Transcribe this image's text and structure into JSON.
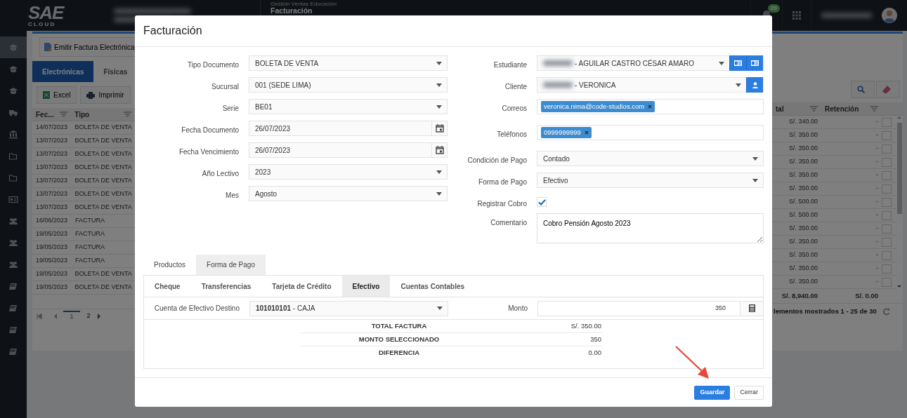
{
  "topbar": {
    "logo": "SAE",
    "logo_sub": "C L O U D",
    "module": "Gestión Ventas Educación",
    "page": "Facturación",
    "notifications": "20"
  },
  "sidebar": {
    "items": [
      {
        "kind": "cap",
        "selected": true
      },
      {
        "kind": "cap",
        "selected": false
      },
      {
        "kind": "cap",
        "selected": false
      },
      {
        "kind": "truck",
        "selected": false
      },
      {
        "kind": "bank",
        "selected": false
      },
      {
        "kind": "folder",
        "selected": false
      },
      {
        "kind": "folder",
        "selected": false
      },
      {
        "kind": "card",
        "selected": false
      },
      {
        "kind": "users",
        "selected": false
      },
      {
        "kind": "users",
        "selected": false
      },
      {
        "kind": "users",
        "selected": false
      },
      {
        "kind": "book",
        "selected": false
      },
      {
        "kind": "book",
        "selected": false
      },
      {
        "kind": "book",
        "selected": false
      },
      {
        "kind": "book",
        "selected": false
      }
    ]
  },
  "background": {
    "emit_button": "Emitir Factura Electrónica",
    "tabs": [
      {
        "label": "Electrónicas",
        "selected": true
      },
      {
        "label": "Físicas",
        "selected": false
      }
    ],
    "toolbar": [
      {
        "label": "Excel",
        "kind": "excel"
      },
      {
        "label": "Imprimir",
        "kind": "print"
      }
    ],
    "table": {
      "columns_left": [
        "Fec...",
        "Tipo"
      ],
      "columns_right": [
        "tal",
        "Retención"
      ],
      "rows": [
        {
          "fecha": "14/07/2023",
          "tipo": "BOLETA DE VENTA",
          "total": "S/. 340.00",
          "retencion": "-"
        },
        {
          "fecha": "13/07/2023",
          "tipo": "BOLETA DE VENTA",
          "total": "S/. 350.00",
          "retencion": "-"
        },
        {
          "fecha": "13/07/2023",
          "tipo": "BOLETA DE VENTA",
          "total": "S/. 350.00",
          "retencion": "-"
        },
        {
          "fecha": "13/07/2023",
          "tipo": "BOLETA DE VENTA",
          "total": "S/. 350.00",
          "retencion": "-"
        },
        {
          "fecha": "13/07/2023",
          "tipo": "BOLETA DE VENTA",
          "total": "S/. 350.00",
          "retencion": "-"
        },
        {
          "fecha": "13/07/2023",
          "tipo": "BOLETA DE VENTA",
          "total": "S/. 350.00",
          "retencion": "-"
        },
        {
          "fecha": "13/07/2023",
          "tipo": "BOLETA DE VENTA",
          "total": "S/. 500.00",
          "retencion": "-"
        },
        {
          "fecha": "16/06/2023",
          "tipo": "FACTURA",
          "total": "S/. 500.00",
          "retencion": "-"
        },
        {
          "fecha": "19/05/2023",
          "tipo": "FACTURA",
          "total": "S/. 350.00",
          "retencion": "-"
        },
        {
          "fecha": "19/05/2023",
          "tipo": "FACTURA",
          "total": "S/. 350.00",
          "retencion": "-"
        },
        {
          "fecha": "19/05/2023",
          "tipo": "FACTURA",
          "total": "S/. 350.00",
          "retencion": "-"
        },
        {
          "fecha": "19/05/2023",
          "tipo": "BOLETA DE VENTA",
          "total": "S/. 350.00",
          "retencion": "-"
        },
        {
          "fecha": "19/05/2023",
          "tipo": "BOLETA DE VENTA",
          "total": "S/. 350.00",
          "retencion": "-"
        }
      ],
      "totals": [
        "S/. 8,940.00",
        "S/. 0.00"
      ]
    },
    "pages": [
      {
        "label": "1",
        "selected": true
      },
      {
        "label": "2",
        "selected": false
      }
    ],
    "status": "lementos mostrados 1 - 25 de 30"
  },
  "modal": {
    "title": "Facturación",
    "left_fields": [
      {
        "label": "Tipo Documento",
        "kind": "select",
        "value": "BOLETA DE VENTA"
      },
      {
        "label": "Sucursal",
        "kind": "select",
        "value": "001 (SEDE LIMA)"
      },
      {
        "label": "Serie",
        "kind": "select",
        "value": "BE01"
      },
      {
        "label": "Fecha Documento",
        "kind": "date",
        "value": "26/07/2023"
      },
      {
        "label": "Fecha Vencimiento",
        "kind": "date",
        "value": "26/07/2023"
      },
      {
        "label": "Año Lectivo",
        "kind": "select",
        "value": "2023"
      },
      {
        "label": "Mes",
        "kind": "select",
        "value": "Agosto"
      }
    ],
    "right_fields": [
      {
        "label": "Estudiante",
        "kind": "select",
        "redacted": true,
        "value": "- AGUILAR CASTRO CÉSAR AMARO",
        "addons": [
          {
            "kind": "card"
          },
          {
            "kind": "card"
          }
        ]
      },
      {
        "label": "Cliente",
        "kind": "select",
        "redacted": true,
        "value": "- VERONICA",
        "addons": [
          {
            "kind": "person"
          }
        ]
      },
      {
        "label": "Correos",
        "kind": "tags",
        "tags": [
          "veronica.nima@code-studios.com"
        ]
      },
      {
        "label": "Teléfonos",
        "kind": "tags",
        "tags": [
          "0999999999"
        ]
      },
      {
        "label": "Condición de Pago",
        "kind": "select",
        "value": "Contado"
      },
      {
        "label": "Forma de Pago",
        "kind": "select",
        "value": "Efectivo"
      },
      {
        "label": "Registrar Cobro",
        "kind": "checkbox",
        "checked": true
      },
      {
        "label": "Comentario",
        "kind": "textarea",
        "value": "Cobro Pensión Agosto 2023"
      }
    ],
    "tabs": [
      {
        "label": "Productos",
        "selected": false
      },
      {
        "label": "Forma de Pago",
        "selected": true
      }
    ],
    "payment_tabs": [
      {
        "label": "Cheque",
        "selected": false
      },
      {
        "label": "Transferencias",
        "selected": false
      },
      {
        "label": "Tarjeta de Crédito",
        "selected": false
      },
      {
        "label": "Efectivo",
        "selected": true
      },
      {
        "label": "Cuentas Contables",
        "selected": false
      }
    ],
    "account_label": "Cuenta de Efectivo Destino",
    "account_value": "**101010101** - CAJA",
    "amount_label": "Monto",
    "amount_value": "350",
    "summary": [
      {
        "label": "TOTAL FACTURA",
        "value": "S/. 350.00"
      },
      {
        "label": "MONTO SELECCIONADO",
        "value": "350"
      },
      {
        "label": "DIFERENCIA",
        "value": "0.00"
      }
    ],
    "buttons": [
      {
        "label": "Guardar",
        "kind": "primary"
      },
      {
        "label": "Cerrar",
        "kind": "secondary"
      }
    ]
  }
}
